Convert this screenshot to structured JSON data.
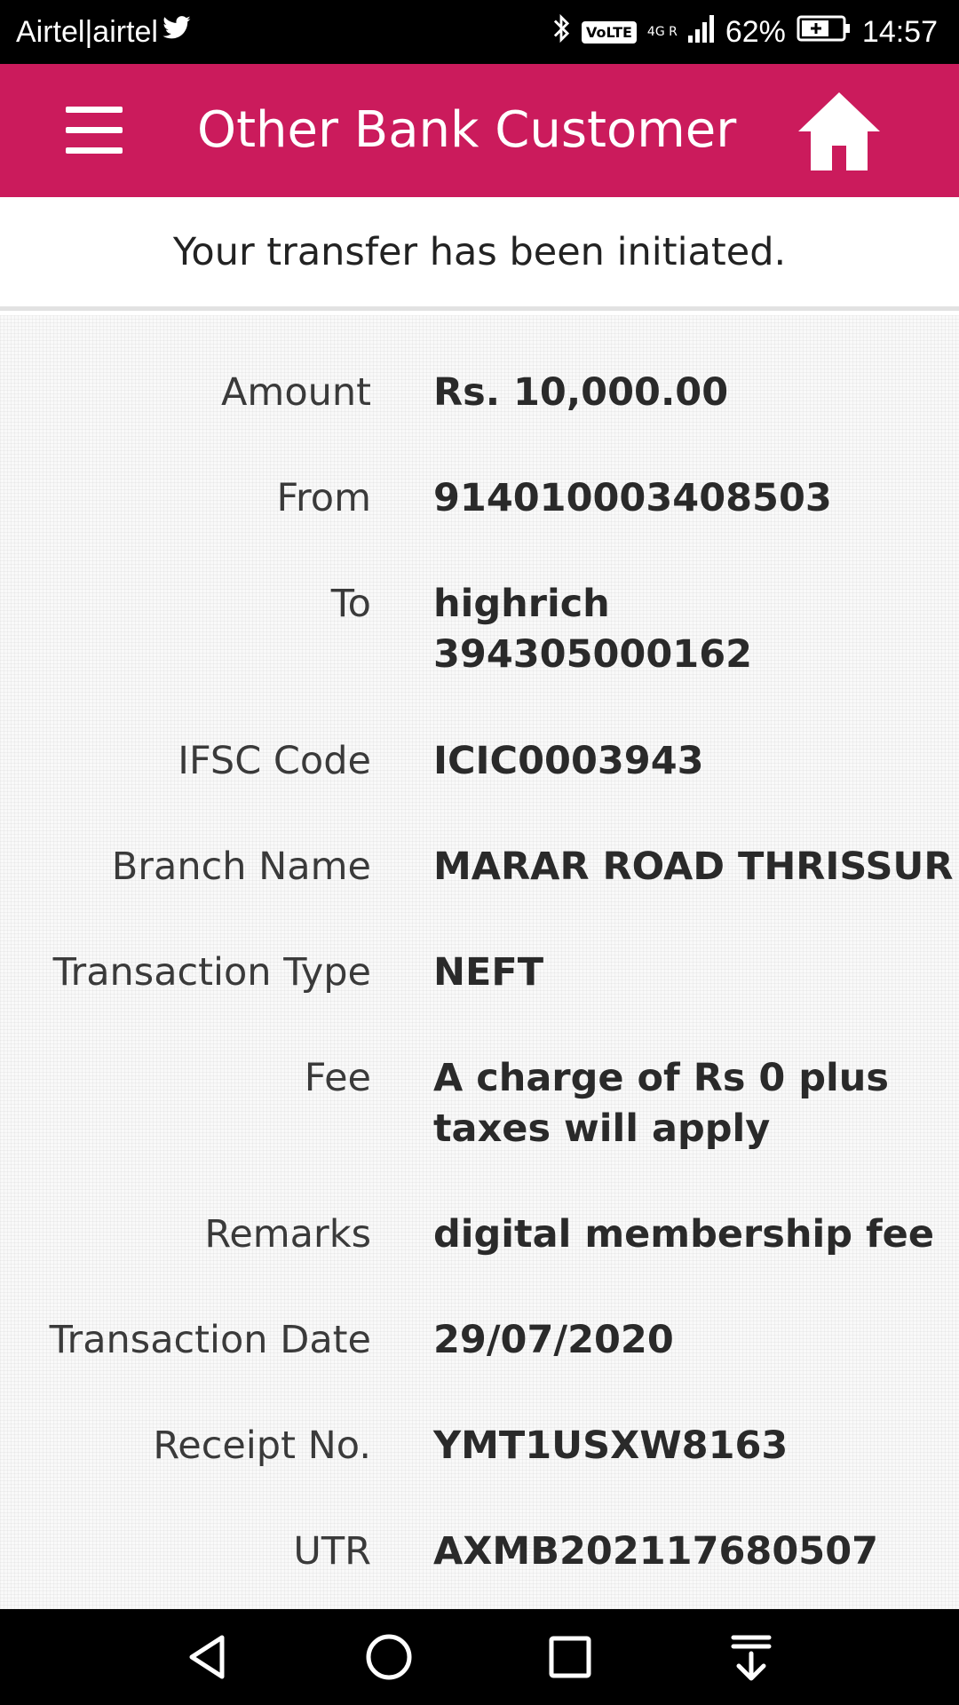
{
  "status_bar": {
    "carrier": "Airtel|airtel",
    "network_label": "VoLTE",
    "network_type": "4G R",
    "battery": "62%",
    "time": "14:57",
    "icons": [
      "twitter-icon",
      "bluetooth-icon",
      "signal-icon",
      "battery-icon"
    ]
  },
  "header": {
    "title": "Other Bank Customer",
    "menu_icon": "hamburger-menu-icon",
    "home_icon": "home-icon",
    "background_color": "#cb1b5c"
  },
  "message": "Your transfer has been initiated.",
  "details": [
    {
      "label": "Amount",
      "value": [
        "Rs. 10,000.00"
      ]
    },
    {
      "label": "From",
      "value": [
        "914010003408503"
      ]
    },
    {
      "label": "To",
      "value": [
        "highrich",
        "394305000162"
      ]
    },
    {
      "label": "IFSC Code",
      "value": [
        "ICIC0003943"
      ]
    },
    {
      "label": "Branch Name",
      "value": [
        "MARAR ROAD THRISSUR"
      ]
    },
    {
      "label": "Transaction Type",
      "value": [
        "NEFT"
      ]
    },
    {
      "label": "Fee",
      "value": [
        "A charge of Rs 0 plus",
        "taxes will apply"
      ]
    },
    {
      "label": "Remarks",
      "value": [
        "digital membership fee"
      ]
    },
    {
      "label": "Transaction Date",
      "value": [
        "29/07/2020"
      ]
    },
    {
      "label": "Receipt No.",
      "value": [
        "YMT1USXW8163"
      ]
    },
    {
      "label": "UTR",
      "value": [
        "AXMB202117680507"
      ]
    }
  ],
  "nav_bar": {
    "icons": [
      "back-icon",
      "home-circle-icon",
      "recents-icon",
      "notification-pull-icon"
    ]
  }
}
